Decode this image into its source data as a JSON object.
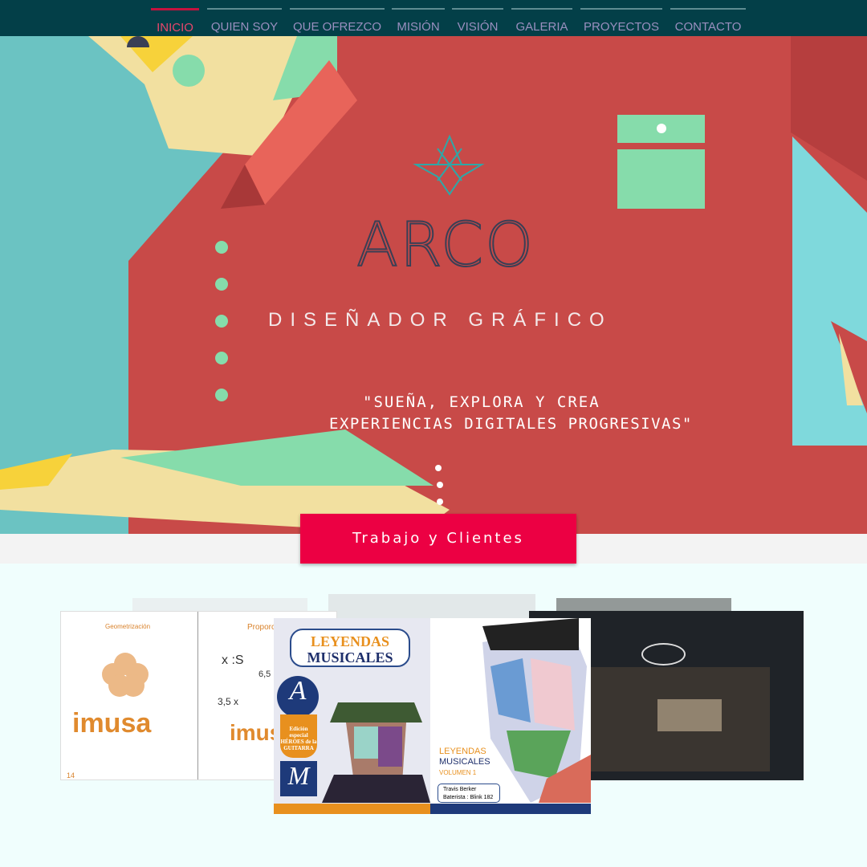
{
  "nav": {
    "items": [
      "INICIO",
      "QUIEN SOY",
      "QUE OFREZCO",
      "MISIÓN",
      "VISIÓN",
      "GALERIA",
      "PROYECTOS",
      "CONTACTO"
    ],
    "active": "INICIO"
  },
  "hero": {
    "logo": "ARCO",
    "subtitle": "DISEÑADOR GRÁFICO",
    "quote_line1": "\"SUEÑA, EXPLORA Y CREA",
    "quote_line2": "EXPERIENCIAS DIGITALES PROGRESIVAS\""
  },
  "cta": {
    "label": "Trabajo y Clientes"
  },
  "gallery": {
    "left": {
      "heading1": "Geometrización",
      "heading2": "Proporci",
      "brand": "imusa",
      "page": "14",
      "formula1": "x :S",
      "formula2": "6,5",
      "formula3": "3,5 x"
    },
    "center": {
      "title1": "LEYENDAS",
      "title2": "MUSICALES",
      "badge1": "A",
      "badge2": "Edición especial",
      "badge3": "HÉROES de la GUITARRA",
      "badge4": "M",
      "r_title1": "LEYENDAS",
      "r_title2": "MUSICALES",
      "r_vol": "VOLUMEN 1",
      "r_name": "Travis Berker",
      "r_role": "Baterista : Blink 182"
    }
  },
  "colors": {
    "nav_bg": "#033f48",
    "hero_red": "#c84a48",
    "accent": "#ec0043",
    "mint": "#86dcab",
    "teal": "#6bc3c2"
  }
}
